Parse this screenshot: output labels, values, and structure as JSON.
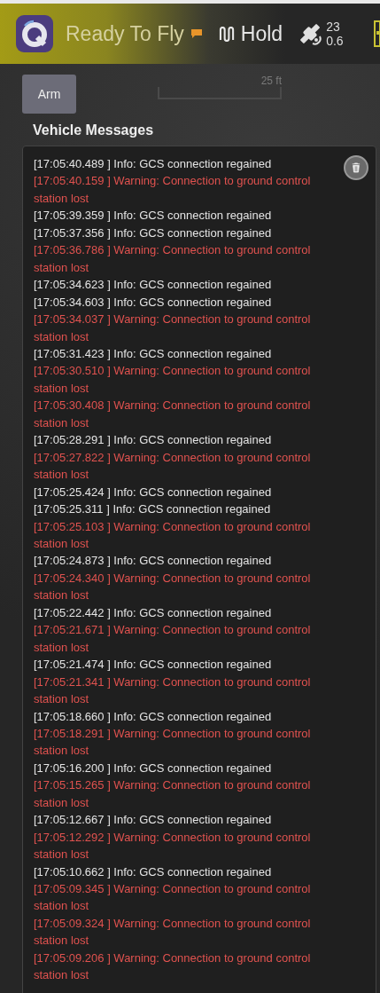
{
  "toolbar": {
    "status": "Ready To Fly",
    "flight_mode": "Hold",
    "satellites": "23",
    "hdop": "0.6"
  },
  "map": {
    "scale_label": "25 ft"
  },
  "arm_button": "Arm",
  "messages_panel": {
    "title": "Vehicle Messages",
    "messages": [
      {
        "kind": "info",
        "text": "[17:05:40.489 ] Info: GCS connection regained"
      },
      {
        "kind": "warning",
        "text": "[17:05:40.159 ] Warning: Connection to ground control station lost"
      },
      {
        "kind": "info",
        "text": "[17:05:39.359 ] Info: GCS connection regained"
      },
      {
        "kind": "info",
        "text": "[17:05:37.356 ] Info: GCS connection regained"
      },
      {
        "kind": "warning",
        "text": "[17:05:36.786 ] Warning: Connection to ground control station lost"
      },
      {
        "kind": "info",
        "text": "[17:05:34.623 ] Info: GCS connection regained"
      },
      {
        "kind": "info",
        "text": "[17:05:34.603 ] Info: GCS connection regained"
      },
      {
        "kind": "warning",
        "text": "[17:05:34.037 ] Warning: Connection to ground control station lost"
      },
      {
        "kind": "info",
        "text": "[17:05:31.423 ] Info: GCS connection regained"
      },
      {
        "kind": "warning",
        "text": "[17:05:30.510 ] Warning: Connection to ground control station lost"
      },
      {
        "kind": "warning",
        "text": "[17:05:30.408 ] Warning: Connection to ground control station lost"
      },
      {
        "kind": "info",
        "text": "[17:05:28.291 ] Info: GCS connection regained"
      },
      {
        "kind": "warning",
        "text": "[17:05:27.822 ] Warning: Connection to ground control station lost"
      },
      {
        "kind": "info",
        "text": "[17:05:25.424 ] Info: GCS connection regained"
      },
      {
        "kind": "info",
        "text": "[17:05:25.311 ] Info: GCS connection regained"
      },
      {
        "kind": "warning",
        "text": "[17:05:25.103 ] Warning: Connection to ground control station lost"
      },
      {
        "kind": "info",
        "text": "[17:05:24.873 ] Info: GCS connection regained"
      },
      {
        "kind": "warning",
        "text": "[17:05:24.340 ] Warning: Connection to ground control station lost"
      },
      {
        "kind": "info",
        "text": "[17:05:22.442 ] Info: GCS connection regained"
      },
      {
        "kind": "warning",
        "text": "[17:05:21.671 ] Warning: Connection to ground control station lost"
      },
      {
        "kind": "info",
        "text": "[17:05:21.474 ] Info: GCS connection regained"
      },
      {
        "kind": "warning",
        "text": "[17:05:21.341 ] Warning: Connection to ground control station lost"
      },
      {
        "kind": "info",
        "text": "[17:05:18.660 ] Info: GCS connection regained"
      },
      {
        "kind": "warning",
        "text": "[17:05:18.291 ] Warning: Connection to ground control station lost"
      },
      {
        "kind": "info",
        "text": "[17:05:16.200 ] Info: GCS connection regained"
      },
      {
        "kind": "warning",
        "text": "[17:05:15.265 ] Warning: Connection to ground control station lost"
      },
      {
        "kind": "info",
        "text": "[17:05:12.667 ] Info: GCS connection regained"
      },
      {
        "kind": "warning",
        "text": "[17:05:12.292 ] Warning: Connection to ground control station lost"
      },
      {
        "kind": "info",
        "text": "[17:05:10.662 ] Info: GCS connection regained"
      },
      {
        "kind": "warning",
        "text": "[17:05:09.345 ] Warning: Connection to ground control station lost"
      },
      {
        "kind": "warning",
        "text": "[17:05:09.324 ] Warning: Connection to ground control station lost"
      },
      {
        "kind": "warning",
        "text": "[17:05:09.206 ] Warning: Connection to ground control station lost"
      }
    ]
  }
}
